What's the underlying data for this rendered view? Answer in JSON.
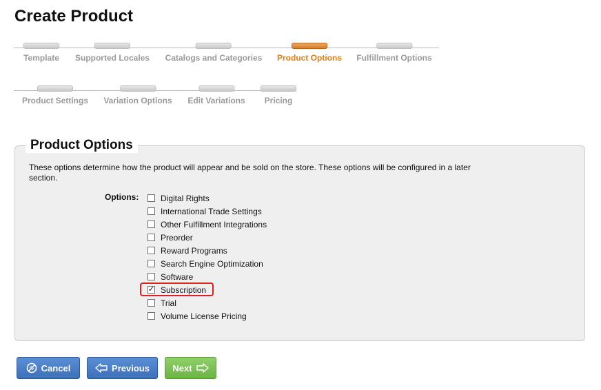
{
  "page": {
    "title": "Create Product"
  },
  "wizard": {
    "row1": [
      {
        "label": "Template",
        "active": false
      },
      {
        "label": "Supported Locales",
        "active": false
      },
      {
        "label": "Catalogs and Categories",
        "active": false
      },
      {
        "label": "Product Options",
        "active": true
      },
      {
        "label": "Fulfillment Options",
        "active": false
      }
    ],
    "row2": [
      {
        "label": "Product Settings",
        "active": false
      },
      {
        "label": "Variation Options",
        "active": false
      },
      {
        "label": "Edit Variations",
        "active": false
      },
      {
        "label": "Pricing",
        "active": false
      }
    ]
  },
  "panel": {
    "title": "Product Options",
    "description": "These options determine how the product will appear and be sold on the store. These options will be configured in a later section.",
    "options_label": "Options:",
    "options": [
      {
        "label": "Digital Rights",
        "checked": false
      },
      {
        "label": "International Trade Settings",
        "checked": false
      },
      {
        "label": "Other Fulfillment Integrations",
        "checked": false
      },
      {
        "label": "Preorder",
        "checked": false
      },
      {
        "label": "Reward Programs",
        "checked": false
      },
      {
        "label": "Search Engine Optimization",
        "checked": false
      },
      {
        "label": "Software",
        "checked": false
      },
      {
        "label": "Subscription",
        "checked": true
      },
      {
        "label": "Trial",
        "checked": false
      },
      {
        "label": "Volume License Pricing",
        "checked": false
      }
    ]
  },
  "buttons": {
    "cancel": "Cancel",
    "previous": "Previous",
    "next": "Next"
  },
  "colors": {
    "active_step": "#de7f1c",
    "button_blue": "#4a7dc6",
    "button_green": "#7cc155",
    "highlight": "#e02020"
  }
}
